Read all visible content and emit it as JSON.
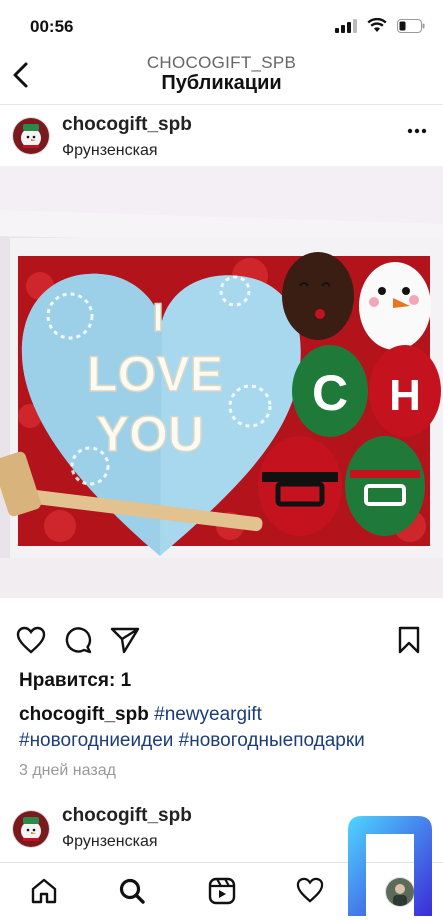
{
  "status_bar": {
    "time": "00:56"
  },
  "nav": {
    "account": "CHOCOGIFT_SPB",
    "title": "Публикации"
  },
  "post": {
    "username": "chocogift_spb",
    "location": "Фрунзенская",
    "photo_text": [
      "I",
      "LOVE",
      "YOU"
    ],
    "likes": "Нравится: 1",
    "caption_username": "chocogift_spb",
    "caption_tags": "#newyeargift",
    "caption_tags_line2": "#новогодниеидеи #новогодныеподарки",
    "date": "3 дней назад"
  },
  "next_post": {
    "username": "chocogift_spb",
    "location": "Фрунзенская"
  },
  "tabbar": {
    "items": [
      "home-icon",
      "search-icon",
      "reels-icon",
      "heart-icon",
      "profile-avatar"
    ]
  },
  "colors": {
    "hashtag": "#1b3d7a",
    "heart_blue": "#a8d8ee",
    "berry_red": "#c4121f",
    "berry_green": "#1f7a3a"
  }
}
